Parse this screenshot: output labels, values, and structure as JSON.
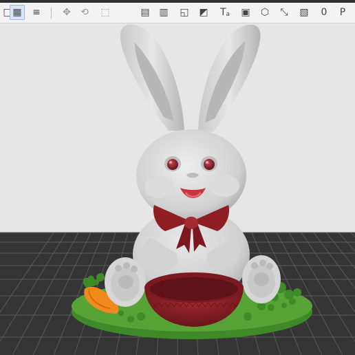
{
  "app": {
    "toolbar": {
      "tools": [
        {
          "name": "add-object-tool",
          "icon": "add-object-icon",
          "glyph": "□"
        },
        {
          "name": "arrange-tool",
          "icon": "arrange-icon",
          "glyph": "▦"
        },
        {
          "name": "layers-tool",
          "icon": "layers-icon",
          "glyph": "≡"
        },
        {
          "name": "move-tool",
          "icon": "move-icon",
          "glyph": "✥"
        },
        {
          "name": "rotate-tool",
          "icon": "rotate-icon",
          "glyph": "⟲"
        },
        {
          "name": "scale-tool",
          "icon": "scale-icon",
          "glyph": "⬚"
        },
        {
          "name": "place-on-face-tool",
          "icon": "place-on-face-icon",
          "glyph": "▤"
        },
        {
          "name": "cut-tool",
          "icon": "cut-icon",
          "glyph": "▥"
        },
        {
          "name": "paint-seam-tool",
          "icon": "seam-icon",
          "glyph": "◱"
        },
        {
          "name": "color-paint-tool",
          "icon": "paint-bucket-icon",
          "glyph": "◩"
        },
        {
          "name": "text-tool",
          "icon": "text-icon",
          "glyph": "T"
        },
        {
          "name": "measure-tool",
          "icon": "measure-icon",
          "glyph": "▣"
        },
        {
          "name": "view-cube-tool",
          "icon": "cube-icon",
          "glyph": "⬡"
        },
        {
          "name": "fit-view-tool",
          "icon": "fit-view-icon",
          "glyph": "⤡"
        },
        {
          "name": "assembly-tool",
          "icon": "assembly-icon",
          "glyph": "▧"
        },
        {
          "name": "zero-layer-tool",
          "icon": "zero-icon",
          "glyph": "0"
        },
        {
          "name": "preview-tool",
          "icon": "preview-icon",
          "glyph": "P"
        }
      ]
    },
    "text_tool_subscript": "a"
  },
  "scene": {
    "object": "bunny-with-bowl",
    "colors": {
      "background": "#e6e6e6",
      "bed": "#353535",
      "bed_grid": "#5a5a5a",
      "model_body": "#d4d4d4",
      "model_shadow": "#a9a9a9",
      "bow": "#8e1d24",
      "bowl": "#8d1f26",
      "base": "#4f9a32",
      "carrot": "#f28c1e"
    }
  }
}
